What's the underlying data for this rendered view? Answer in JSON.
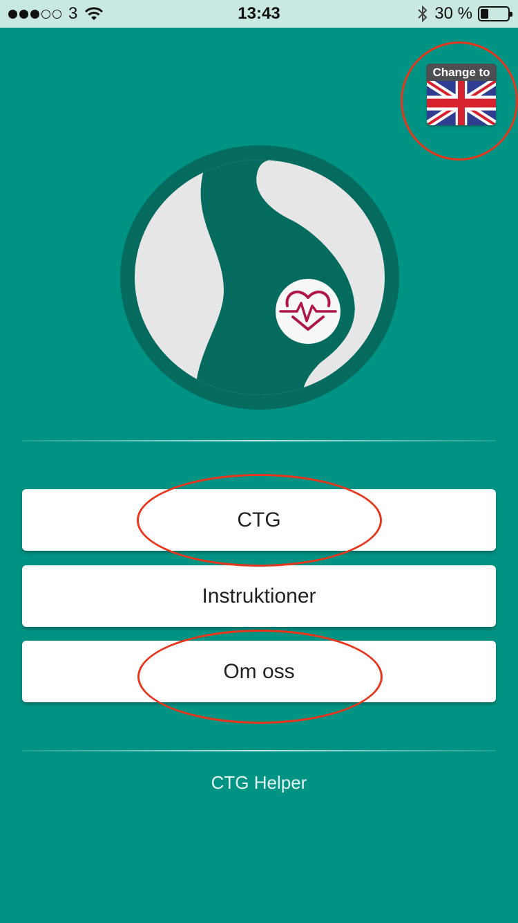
{
  "status_bar": {
    "carrier": "3",
    "time": "13:43",
    "battery_percent": "30 %",
    "battery_level": 0.3,
    "signal_bars": 3,
    "signal_total": 5,
    "icons": [
      "signal-dots-icon",
      "wifi-icon",
      "bluetooth-icon",
      "battery-icon"
    ]
  },
  "language_switch": {
    "label": "Change to",
    "icon": "uk-flag-icon"
  },
  "logo": {
    "icon": "pregnant-woman-heartbeat-logo",
    "colors": {
      "ring": "#056b5e",
      "background": "#e6e6e6",
      "figure": "#056b5e",
      "heart": "#b0164a"
    }
  },
  "menu": {
    "items": [
      {
        "label": "CTG"
      },
      {
        "label": "Instruktioner"
      },
      {
        "label": "Om oss"
      }
    ]
  },
  "footer": {
    "text": "CTG Helper"
  },
  "colors": {
    "background": "#009383",
    "status_bar": "#c9e8e2",
    "annotation": "#e8361c",
    "button": "#ffffff"
  }
}
